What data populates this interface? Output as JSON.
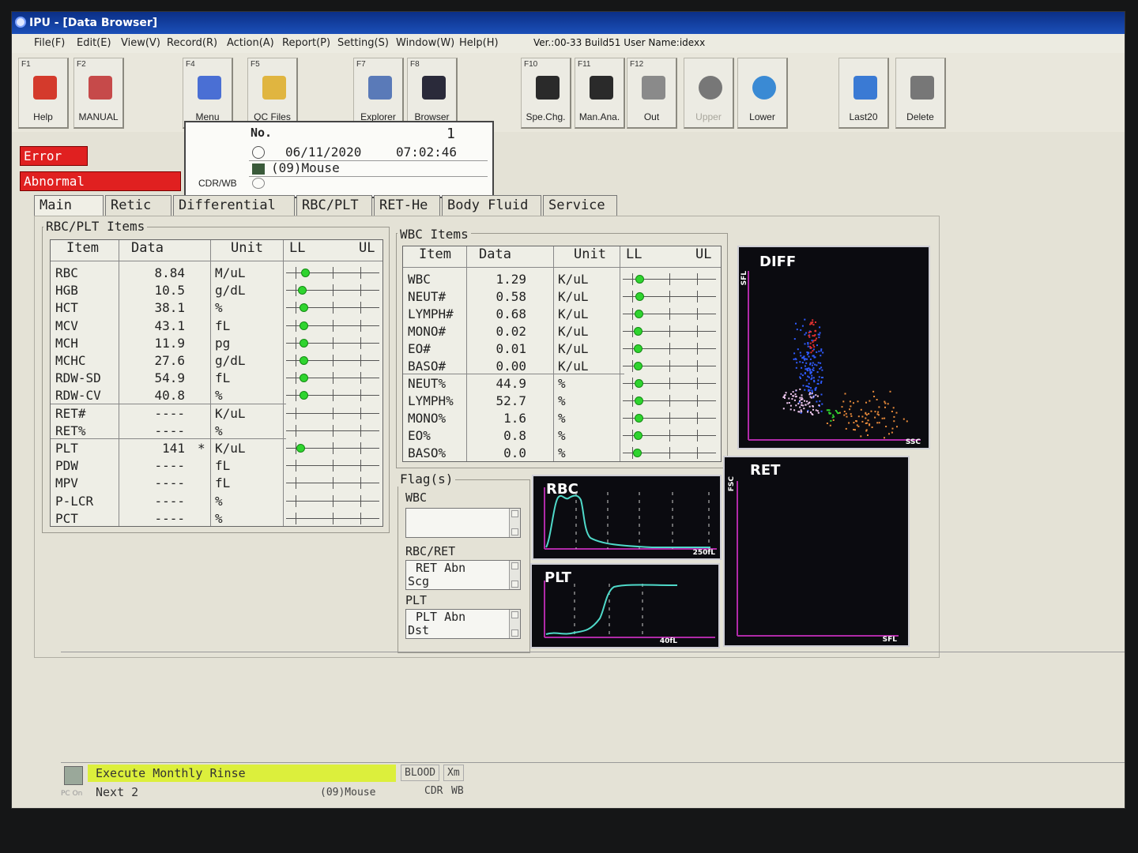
{
  "window": {
    "title": "IPU - [Data Browser]"
  },
  "menu": [
    "File(F)",
    "Edit(E)",
    "View(V)",
    "Record(R)",
    "Action(A)",
    "Report(P)",
    "Setting(S)",
    "Window(W)",
    "Help(H)"
  ],
  "version_text": "Ver.:00-33 Build51 User Name:idexx",
  "toolbar": [
    {
      "key": "F1",
      "label": "Help",
      "icon": "help-icon",
      "color": "#d43a2c"
    },
    {
      "key": "F2",
      "label": "MANUAL",
      "icon": "manual-icon",
      "color": "#c64a4a"
    },
    {
      "key": "F4",
      "label": "Menu",
      "icon": "menu-grid-icon",
      "color": "#4a6fd4"
    },
    {
      "key": "F5",
      "label": "QC Files",
      "icon": "folder-icon",
      "color": "#e0b540"
    },
    {
      "key": "F7",
      "label": "Explorer",
      "icon": "explorer-icon",
      "color": "#5a7ab8"
    },
    {
      "key": "F8",
      "label": "Browser",
      "icon": "browser-icon",
      "color": "#2a2a3a"
    },
    {
      "key": "F10",
      "label": "Spe.Chg.",
      "icon": "sample-change-icon",
      "color": "#2a2a2a"
    },
    {
      "key": "F11",
      "label": "Man.Ana.",
      "icon": "manual-analysis-icon",
      "color": "#2a2a2a"
    },
    {
      "key": "F12",
      "label": "Out",
      "icon": "output-icon",
      "color": "#8a8a8a"
    },
    {
      "key": "",
      "label": "Upper",
      "icon": "upper-icon",
      "color": "#777777",
      "disabled": true
    },
    {
      "key": "",
      "label": "Lower",
      "icon": "lower-icon",
      "color": "#3a8ad4"
    },
    {
      "key": "",
      "label": "Last20",
      "icon": "clock-icon",
      "color": "#3a7ad4"
    },
    {
      "key": "",
      "label": "Delete",
      "icon": "trash-icon",
      "color": "#777777"
    }
  ],
  "status": {
    "error": "Error",
    "abnormal": "Abnormal"
  },
  "sample": {
    "no_label": "No.",
    "no_value": "1",
    "date": "06/11/2020",
    "time": "07:02:46",
    "species": "(09)Mouse",
    "mode": "CDR/WB"
  },
  "tabs": [
    "Main",
    "Retic",
    "Differential",
    "RBC/PLT",
    "RET-He",
    "Body Fluid",
    "Service"
  ],
  "rbc_group": {
    "legend": "RBC/PLT Items",
    "headers": {
      "item": "Item",
      "data": "Data",
      "unit": "Unit",
      "ll": "LL",
      "ul": "UL"
    },
    "rows": [
      {
        "item": "RBC",
        "data": "8.84",
        "unit": "M/uL",
        "mark": "",
        "pos": 0.2
      },
      {
        "item": "HGB",
        "data": "10.5",
        "unit": "g/dL",
        "mark": "",
        "pos": 0.17
      },
      {
        "item": "HCT",
        "data": "38.1",
        "unit": "%",
        "mark": "",
        "pos": 0.19
      },
      {
        "item": "MCV",
        "data": "43.1",
        "unit": "fL",
        "mark": "",
        "pos": 0.19
      },
      {
        "item": "MCH",
        "data": "11.9",
        "unit": "pg",
        "mark": "",
        "pos": 0.19
      },
      {
        "item": "MCHC",
        "data": "27.6",
        "unit": "g/dL",
        "mark": "",
        "pos": 0.19
      },
      {
        "item": "RDW-SD",
        "data": "54.9",
        "unit": "fL",
        "mark": "",
        "pos": 0.19
      },
      {
        "item": "RDW-CV",
        "data": "40.8",
        "unit": "%",
        "mark": "",
        "pos": 0.19
      },
      {
        "item": "RET#",
        "data": "----",
        "unit": "K/uL",
        "mark": "",
        "pos": null
      },
      {
        "item": "RET%",
        "data": "----",
        "unit": "%",
        "mark": "",
        "pos": null
      },
      {
        "item": "PLT",
        "data": "141",
        "unit": "K/uL",
        "mark": "*",
        "pos": 0.15
      },
      {
        "item": "PDW",
        "data": "----",
        "unit": "fL",
        "mark": "",
        "pos": null
      },
      {
        "item": "MPV",
        "data": "----",
        "unit": "fL",
        "mark": "",
        "pos": null
      },
      {
        "item": "P-LCR",
        "data": "----",
        "unit": "%",
        "mark": "",
        "pos": null
      },
      {
        "item": "PCT",
        "data": "----",
        "unit": "%",
        "mark": "",
        "pos": null
      }
    ]
  },
  "wbc_group": {
    "legend": "WBC Items",
    "headers": {
      "item": "Item",
      "data": "Data",
      "unit": "Unit",
      "ll": "LL",
      "ul": "UL"
    },
    "rows": [
      {
        "item": "WBC",
        "data": "1.29",
        "unit": "K/uL",
        "pos": 0.18
      },
      {
        "item": "NEUT#",
        "data": "0.58",
        "unit": "K/uL",
        "pos": 0.18
      },
      {
        "item": "LYMPH#",
        "data": "0.68",
        "unit": "K/uL",
        "pos": 0.17
      },
      {
        "item": "MONO#",
        "data": "0.02",
        "unit": "K/uL",
        "pos": 0.16
      },
      {
        "item": "EO#",
        "data": "0.01",
        "unit": "K/uL",
        "pos": 0.16
      },
      {
        "item": "BASO#",
        "data": "0.00",
        "unit": "K/uL",
        "pos": 0.16
      },
      {
        "item": "NEUT%",
        "data": "44.9",
        "unit": "%",
        "pos": 0.17
      },
      {
        "item": "LYMPH%",
        "data": "52.7",
        "unit": "%",
        "pos": 0.17
      },
      {
        "item": "MONO%",
        "data": "1.6",
        "unit": "%",
        "pos": 0.17
      },
      {
        "item": "EO%",
        "data": "0.8",
        "unit": "%",
        "pos": 0.16
      },
      {
        "item": "BASO%",
        "data": "0.0",
        "unit": "%",
        "pos": 0.15
      }
    ]
  },
  "flags": {
    "legend": "Flag(s)",
    "wbc_label": "WBC",
    "rbc_label": "RBC/RET",
    "rbc_lines": [
      "RET Abn",
      "Scg"
    ],
    "plt_label": "PLT",
    "plt_lines": [
      "PLT Abn",
      "Dst"
    ]
  },
  "plots": {
    "diff": {
      "title": "DIFF",
      "ylabel": "SFL",
      "xlabel": "SSC"
    },
    "rbc": {
      "title": "RBC",
      "xlabel": "250fL"
    },
    "plt": {
      "title": "PLT",
      "xlabel": "40fL"
    },
    "ret": {
      "title": "RET",
      "ylabel": "FSC",
      "xlabel": "SFL"
    }
  },
  "statusbar": {
    "message": "Execute Monthly Rinse",
    "next": "Next  2",
    "species": "(09)Mouse",
    "blood": "BLOOD",
    "xm": "Xm",
    "cdr": "CDR",
    "wb": "WB",
    "pc": "PC On"
  },
  "colors": {
    "green_dot": "#2fd42f",
    "error_red": "#e02020",
    "plot_bg": "#0b0b10",
    "curve": "#4fd9c9",
    "axis": "#b02aa8",
    "rinse_yellow": "#dcef3c"
  }
}
